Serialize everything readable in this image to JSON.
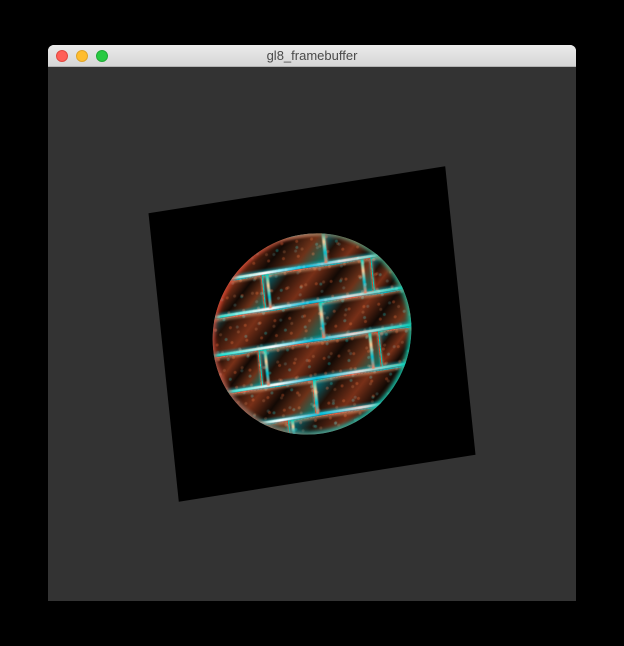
{
  "window": {
    "title": "gl8_framebuffer"
  },
  "colors": {
    "background_outer": "#000000",
    "background_content": "#333333",
    "quad_background": "#000000"
  }
}
